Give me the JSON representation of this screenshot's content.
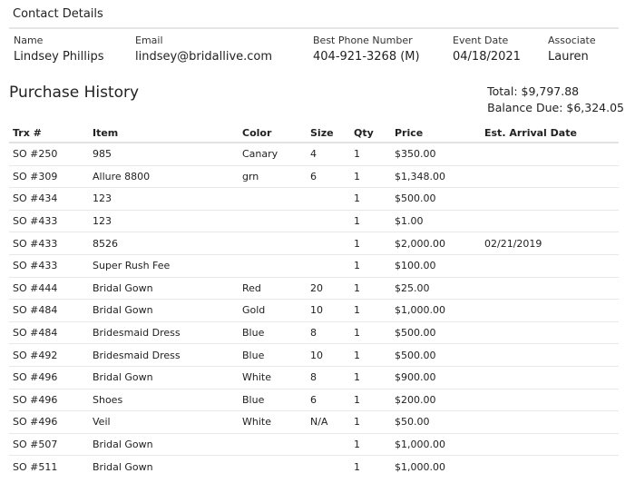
{
  "contact": {
    "title": "Contact Details",
    "name_label": "Name",
    "name": "Lindsey Phillips",
    "email_label": "Email",
    "email": "lindsey@bridallive.com",
    "phone_label": "Best Phone Number",
    "phone": "404-921-3268 (M)",
    "event_label": "Event Date",
    "event_date": "04/18/2021",
    "associate_label": "Associate",
    "associate": "Lauren"
  },
  "purchase": {
    "title": "Purchase History",
    "total": "Total: $9,797.88",
    "balance": "Balance Due: $6,324.05",
    "columns": [
      "Trx #",
      "Item",
      "Color",
      "Size",
      "Qty",
      "Price",
      "Est. Arrival Date"
    ],
    "rows": [
      [
        "SO #250",
        "985",
        "Canary",
        "4",
        "1",
        "$350.00",
        ""
      ],
      [
        "SO #309",
        "Allure 8800",
        "grn",
        "6",
        "1",
        "$1,348.00",
        ""
      ],
      [
        "SO #434",
        "123",
        "",
        "",
        "1",
        "$500.00",
        ""
      ],
      [
        "SO #433",
        "123",
        "",
        "",
        "1",
        "$1.00",
        ""
      ],
      [
        "SO #433",
        "8526",
        "",
        "",
        "1",
        "$2,000.00",
        "02/21/2019"
      ],
      [
        "SO #433",
        "Super Rush Fee",
        "",
        "",
        "1",
        "$100.00",
        ""
      ],
      [
        "SO #444",
        "Bridal Gown",
        "Red",
        "20",
        "1",
        "$25.00",
        ""
      ],
      [
        "SO #484",
        "Bridal Gown",
        "Gold",
        "10",
        "1",
        "$1,000.00",
        ""
      ],
      [
        "SO #484",
        "Bridesmaid Dress",
        "Blue",
        "8",
        "1",
        "$500.00",
        ""
      ],
      [
        "SO #492",
        "Bridesmaid Dress",
        "Blue",
        "10",
        "1",
        "$500.00",
        ""
      ],
      [
        "SO #496",
        "Bridal Gown",
        "White",
        "8",
        "1",
        "$900.00",
        ""
      ],
      [
        "SO #496",
        "Shoes",
        "Blue",
        "6",
        "1",
        "$200.00",
        ""
      ],
      [
        "SO #496",
        "Veil",
        "White",
        "N/A",
        "1",
        "$50.00",
        ""
      ],
      [
        "SO #507",
        "Bridal Gown",
        "",
        "",
        "1",
        "$1,000.00",
        ""
      ],
      [
        "SO #511",
        "Bridal Gown",
        "",
        "",
        "1",
        "$1,000.00",
        ""
      ]
    ]
  }
}
